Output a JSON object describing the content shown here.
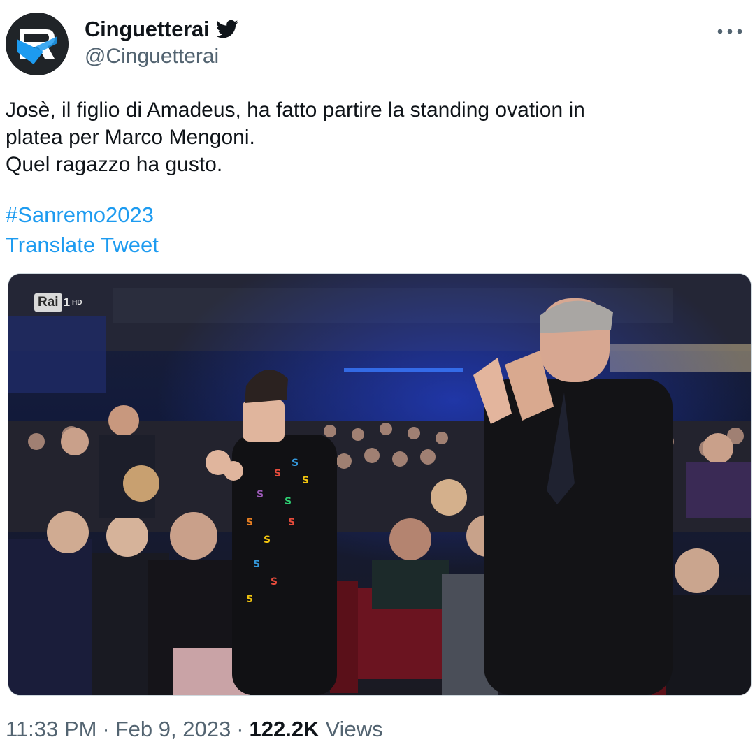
{
  "author": {
    "display_name": "Cinguetterai",
    "handle": "@Cinguetterai",
    "verified_icon": "twitter-bird-icon",
    "avatar_icon": "cinguetterai-logo"
  },
  "more_icon": "more-dots-icon",
  "tweet": {
    "lines": [
      "Josè, il figlio di Amadeus, ha fatto partire la standing ovation in",
      "platea per Marco Mengoni.",
      "Quel ragazzo ha gusto."
    ],
    "hashtag": "#Sanremo2023",
    "translate": "Translate Tweet"
  },
  "media": {
    "broadcaster": "Rai",
    "channel": "1",
    "quality": "HD"
  },
  "meta": {
    "time": "11:33 PM",
    "date": "Feb 9, 2023",
    "separator": "·",
    "views_count": "122.2K",
    "views_label": "Views"
  },
  "colors": {
    "link": "#1d9bf0",
    "secondary_text": "#536471",
    "primary_text": "#0f1419",
    "bird": "#0f1419"
  }
}
